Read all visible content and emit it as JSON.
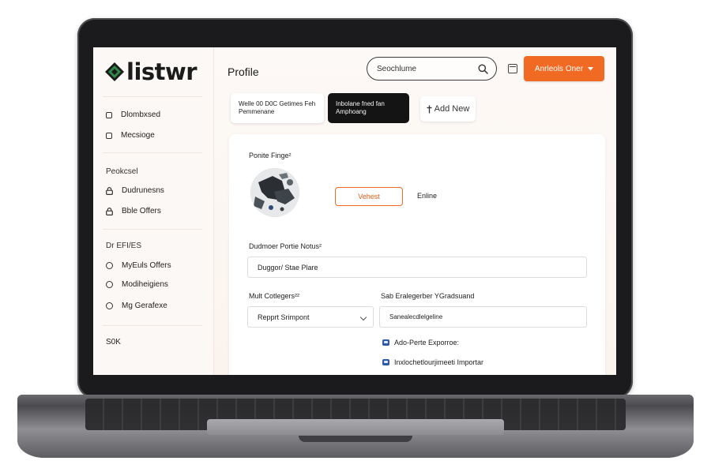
{
  "app": {
    "logo_text": "listwr",
    "page_title": "Profile"
  },
  "sidebar": {
    "items_top": [
      {
        "label": "Dlombxsed",
        "icon": "square-icon"
      },
      {
        "label": "Mecsioge",
        "icon": "square-icon"
      }
    ],
    "section1_heading": "Peokcsel",
    "items_mid": [
      {
        "label": "Dudrunesns",
        "icon": "lock-icon"
      },
      {
        "label": "Bble Offers",
        "icon": "lock-icon"
      }
    ],
    "section2_heading": "Dr  EFI/ES",
    "items_bottom": [
      {
        "label": "MyEuls Offers",
        "icon": "circle-icon"
      },
      {
        "label": "Modiheigiens",
        "icon": "circle-icon"
      },
      {
        "label": "Mg Gerafexe",
        "icon": "circle-icon"
      }
    ],
    "footer": "S0K"
  },
  "header": {
    "search_placeholder": "Seochlume",
    "primary_button": "Anrleols Oner"
  },
  "chips": [
    {
      "line1": "Welle 00 D0C Getimes Feh",
      "line2": "Pemmenane",
      "active": false
    },
    {
      "line1": "Inbolane fned fan",
      "line2": "Amphoang",
      "active": true
    }
  ],
  "add_chip": {
    "icon": "plus",
    "label": "Add New"
  },
  "card": {
    "section_label": "Ponite Finge²",
    "outline_button": "Vehest",
    "status": "Enline",
    "field1_label": "Dudmoer Portie Notus²",
    "field1_value": "Duggor/ Stae Plare",
    "field2_label": "Mult Cotlegers²²",
    "field2_value": "Repprt Srimpont",
    "field3_label": "Sab Eralegerber YGradsuand",
    "field3_value": "Sanealecdlelgeline",
    "checks": [
      {
        "label": "Ado-Perte Exporroe:"
      },
      {
        "label": "Inxlochetlourjimeeti Importar"
      }
    ]
  },
  "colors": {
    "accent": "#f06a24",
    "logo_green": "#1f6b3a",
    "checkbox_blue": "#2e5aa8",
    "chip_dark": "#141414"
  }
}
